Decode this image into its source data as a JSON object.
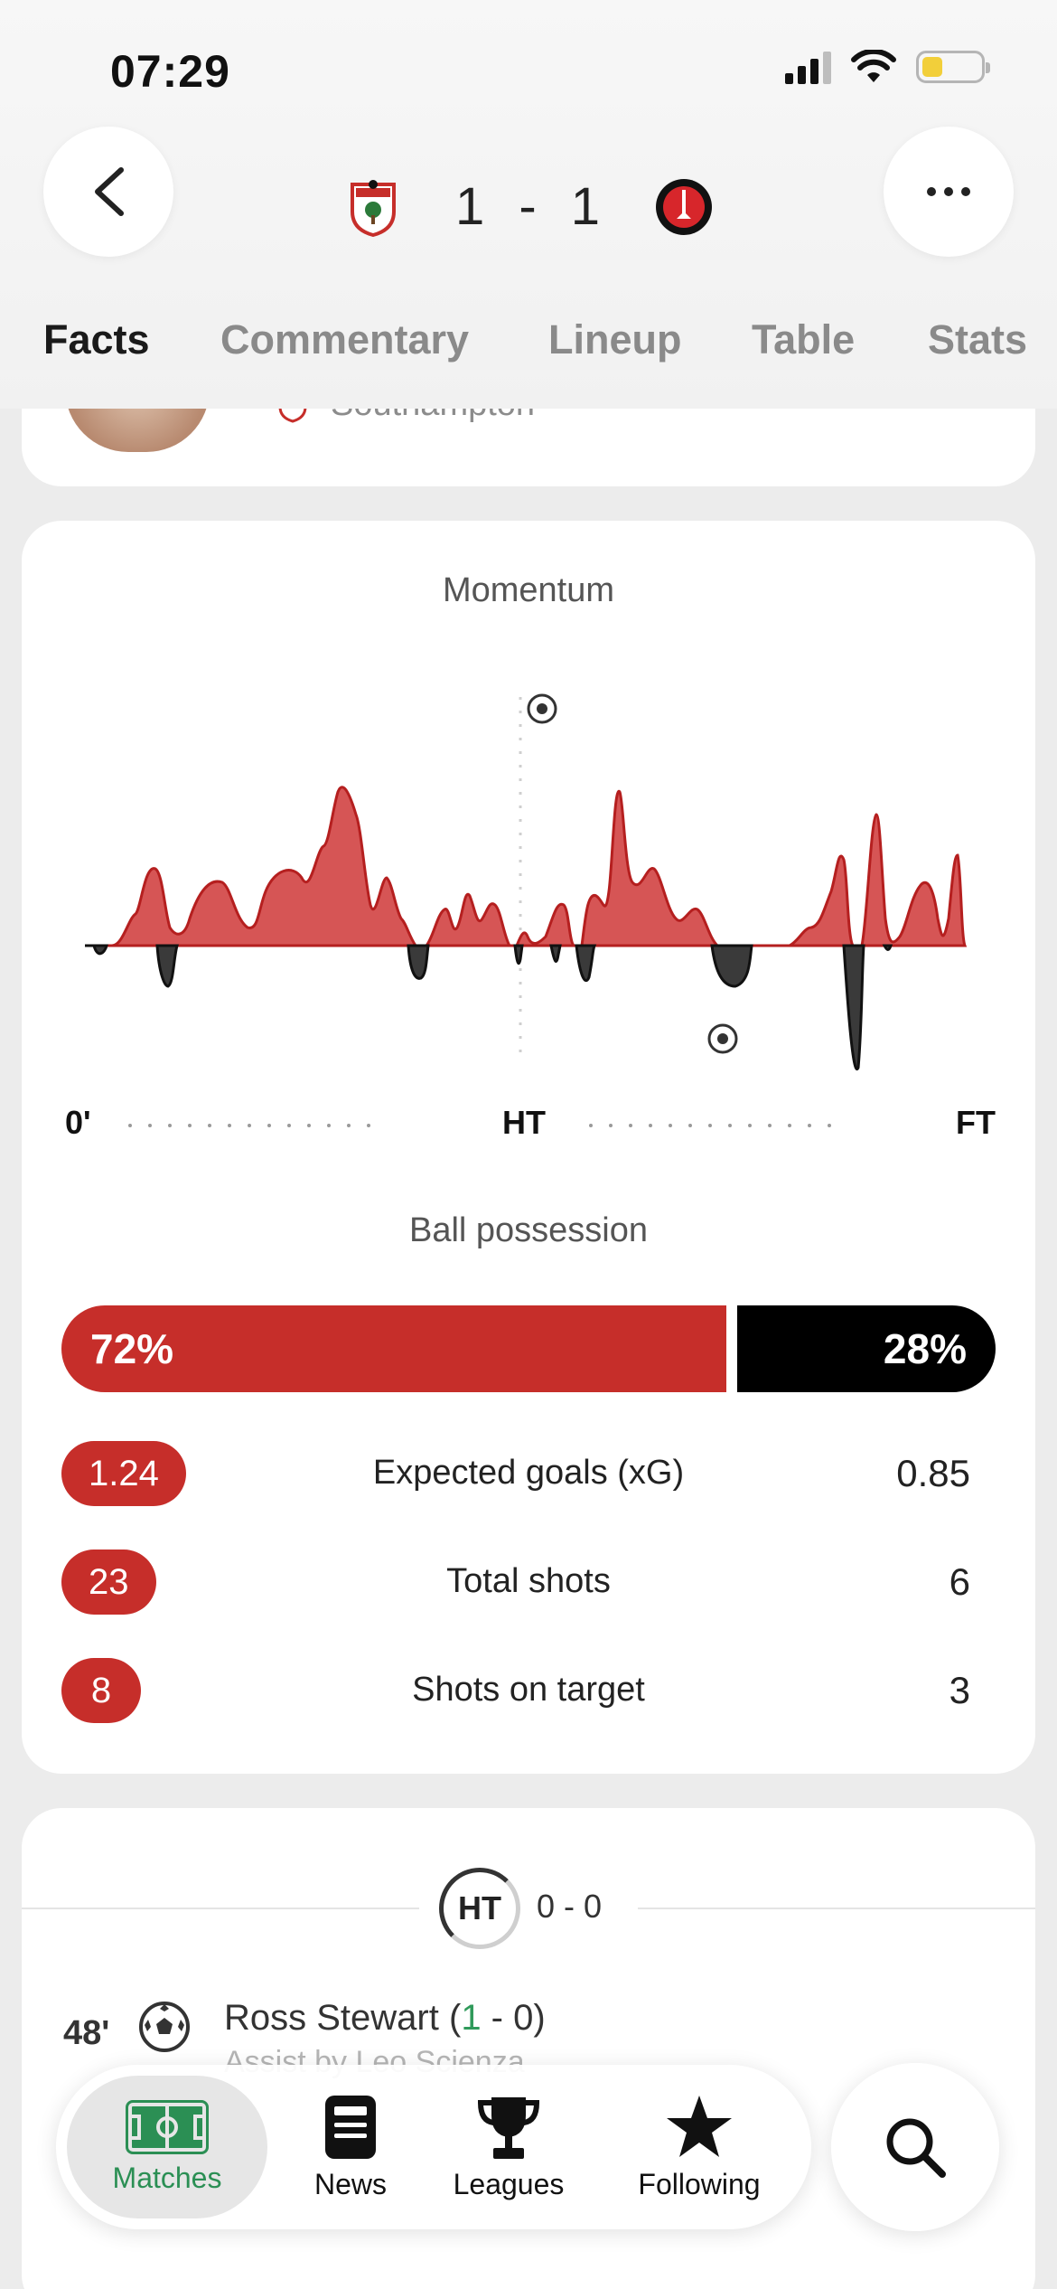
{
  "status_bar": {
    "time": "07:29"
  },
  "header": {
    "home_score": "1",
    "separator": "-",
    "away_score": "1",
    "home_crest": "southampton-crest-icon",
    "away_crest": "charlton-crest-icon"
  },
  "tabs": [
    {
      "label": "Facts",
      "active": true
    },
    {
      "label": "Commentary",
      "active": false
    },
    {
      "label": "Lineup",
      "active": false
    },
    {
      "label": "Table",
      "active": false
    },
    {
      "label": "Stats",
      "active": false
    }
  ],
  "top_card": {
    "player_team": "Southampton"
  },
  "momentum": {
    "title": "Momentum",
    "start_label": "0'",
    "half_label": "HT",
    "end_label": "FT"
  },
  "possession": {
    "title": "Ball possession",
    "home": 72,
    "away": 28,
    "home_label": "72%",
    "away_label": "28%"
  },
  "stats": [
    {
      "label": "Expected goals (xG)",
      "home": "1.24",
      "away": "0.85"
    },
    {
      "label": "Total shots",
      "home": "23",
      "away": "6"
    },
    {
      "label": "Shots on target",
      "home": "8",
      "away": "3"
    }
  ],
  "events": {
    "ht_badge": "HT",
    "ht_score": "0 - 0",
    "goal": {
      "minute": "48'",
      "player": "Ross Stewart",
      "score_open": "(",
      "score_home": "1",
      "score_rest": " - 0)",
      "assist": "Assist by Leo Scienza"
    }
  },
  "nav": [
    {
      "label": "Matches",
      "icon": "pitch-icon",
      "active": true
    },
    {
      "label": "News",
      "icon": "news-icon",
      "active": false
    },
    {
      "label": "Leagues",
      "icon": "trophy-icon",
      "active": false
    },
    {
      "label": "Following",
      "icon": "star-icon",
      "active": false
    }
  ],
  "colors": {
    "home": "#c62e2a",
    "away": "#000000",
    "accent": "#2b8f54"
  }
}
